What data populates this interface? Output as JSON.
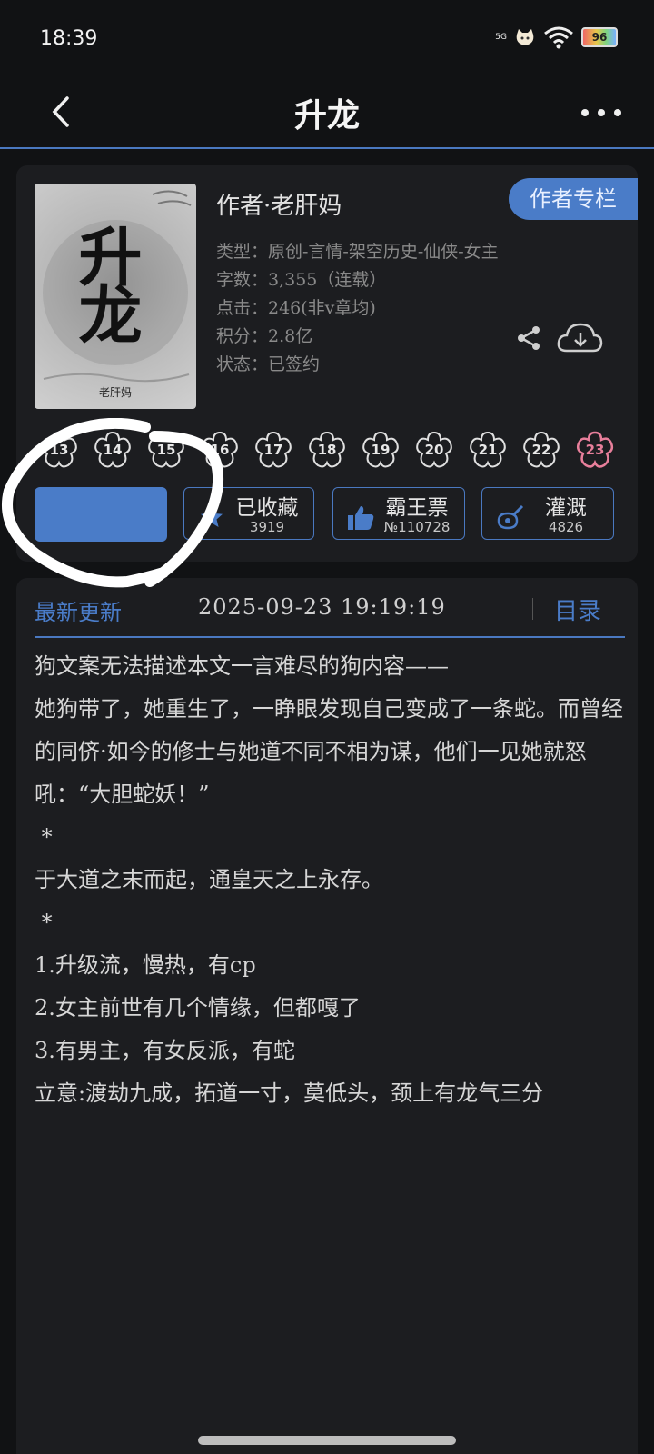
{
  "status": {
    "time": "18:39",
    "network": "5G",
    "battery": "96"
  },
  "nav": {
    "title": "升龙"
  },
  "book": {
    "cover_title": "升龙",
    "cover_author": "老肝妈",
    "author": "作者·老肝妈",
    "author_column": "作者专栏",
    "meta": [
      "类型：原创-言情-架空历史-仙侠-女主",
      "字数：3,355（连载）",
      "点击：246(非v章均)",
      "积分：2.8亿",
      "状态：已签约"
    ]
  },
  "flowers": [
    "13",
    "14",
    "15",
    "16",
    "17",
    "18",
    "19",
    "20",
    "21",
    "22",
    "23"
  ],
  "actions": {
    "collect": {
      "label": "已收藏",
      "count": "3919"
    },
    "ticket": {
      "label": "霸王票",
      "count": "№110728"
    },
    "irrigate": {
      "label": "灌溉",
      "count": "4826"
    }
  },
  "latest": {
    "label": "最新更新",
    "date": "2025-09-23  19:19:19",
    "toc": "目录"
  },
  "intro": [
    "狗文案无法描述本文一言难尽的狗内容——",
    "",
    "她狗带了，她重生了，一睁眼发现自己变成了一条蛇。而曾经的同侪·如今的修士与她道不同不相为谋，他们一见她就怒吼：“大胆蛇妖！”",
    "",
    " *",
    "",
    "于大道之末而起，通皇天之上永存。",
    "",
    " *",
    "",
    "1.升级流，慢热，有cp",
    "2.女主前世有几个情缘，但都嘎了",
    "3.有男主，有女反派，有蛇",
    "",
    "立意:渡劫九成，拓道一寸，莫低头，颈上有龙气三分"
  ]
}
